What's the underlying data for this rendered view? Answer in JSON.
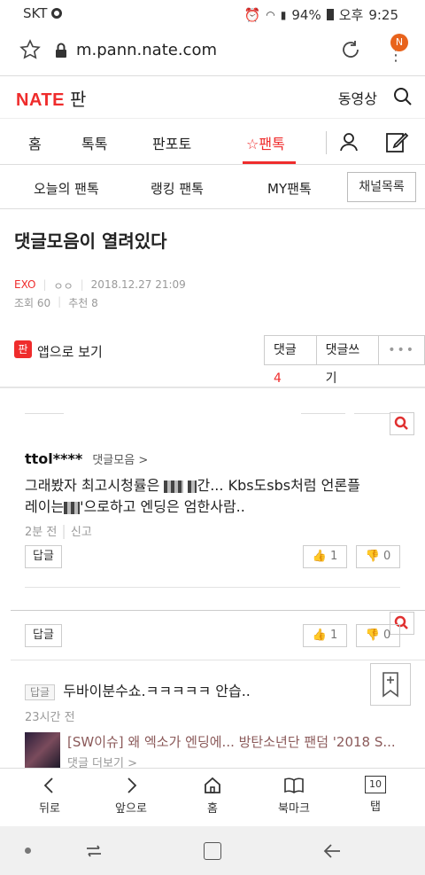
{
  "status": {
    "carrier": "SKT",
    "battery": "94%",
    "ampm": "오후",
    "time": "9:25"
  },
  "address": {
    "url": "m.pann.nate.com",
    "badge": "N"
  },
  "header": {
    "logo": "NATE",
    "pan": "판",
    "video": "동영상"
  },
  "tabs": [
    {
      "label": "홈"
    },
    {
      "label": "톡톡"
    },
    {
      "label": "판포토"
    },
    {
      "label": "팬톡"
    }
  ],
  "subtabs": {
    "today": "오늘의 팬톡",
    "ranking": "랭킹 팬톡",
    "my": "MY팬톡",
    "channel": "채널목록"
  },
  "post": {
    "title": "댓글모음이 열려있다",
    "category": "EXO",
    "author": "ㅇㅇ",
    "date": "2018.12.27 21:09",
    "views": "조회 60",
    "recommend": "추천 8"
  },
  "actions": {
    "app_view": "앱으로 보기",
    "comments_label": "댓글",
    "comments_count": "4",
    "write": "댓글쓰기",
    "more": "•••"
  },
  "comments": [
    {
      "user": "ttol****",
      "board": "댓글모음 >",
      "text_a": "그래봤자 최고시청률은",
      "text_b": "...",
      "text_c": "Kbs도sbs처럼 언론플",
      "text_d": "레이는",
      "text_e": "'으로하고 엔딩은 엄한사람..",
      "time": "2분 전",
      "report": "신고",
      "reply": "답글",
      "up": "1",
      "down": "0"
    },
    {
      "reply": "답글",
      "up": "1",
      "down": "0"
    }
  ],
  "reply_item": {
    "tag": "답글",
    "text": "두바이분수쇼.ㅋㅋㅋㅋㅋ 안습..",
    "time": "23시간 전"
  },
  "related": {
    "title": "[SW이슈] 왜 엑소가 엔딩에... 방탄소년단 팬덤 '2018 S...",
    "more": "댓글 더보기 >"
  },
  "toolbar": {
    "back": "뒤로",
    "forward": "앞으로",
    "home": "홈",
    "bookmark": "북마크",
    "tabs": "탭",
    "tab_count": "10"
  }
}
